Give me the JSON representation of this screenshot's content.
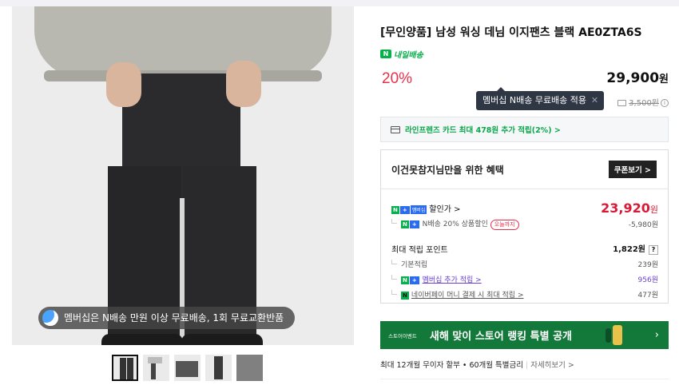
{
  "product": {
    "title": "[무인양품] 남성 워싱 데님 이지팬츠 블랙 AE0ZTA6S",
    "delivery_label": "내일배송",
    "discount": "20%",
    "price": "29,900",
    "price_unit": "원",
    "original_price": "3,500원",
    "tooltip": "멤버십 N배송 무료배송 적용"
  },
  "image_promo": "멤버십은 N배송 만원 이상 무료배송, 1회 무료교환반품",
  "card_offer": "라인프렌즈 카드 최대 478원 추가 적립(2%) >",
  "benefit": {
    "title": "이건못참지님만을 위한 혜택",
    "coupon_button": "쿠폰보기 >",
    "sale_label": "할인가 >",
    "sale_price": "23,920",
    "sale_unit": "원",
    "nsale_text": "N배송 20% 상품할인",
    "today_tag": "오늘까지",
    "nsale_value": "-5,980원",
    "points_label": "최대 적립 포인트",
    "points_value": "1,822원",
    "basic_label": "기본적립",
    "basic_value": "239원",
    "member_label": "멤버십 추가 적립 >",
    "member_value": "956원",
    "pay_label": "네이버페이 머니 결제 시 최대 적립 >",
    "pay_value": "477원"
  },
  "banner": {
    "logo": "스토어이벤트",
    "text": "새해 맞이 스토어 랭킹 특별 공개",
    "arrow": "›"
  },
  "installment": {
    "text": "최대 12개월 무이자 할부 • 60개월 특별금리",
    "more": "자세히보기 >"
  },
  "colors": {
    "accent_red": "#e8304a",
    "naver_green": "#08b04c",
    "banner_green": "#13793a",
    "membership_purple": "#6a3fd4"
  },
  "icons": [
    "truck-icon",
    "info-icon",
    "card-icon",
    "close-icon",
    "membership-n-icon",
    "question-icon"
  ]
}
